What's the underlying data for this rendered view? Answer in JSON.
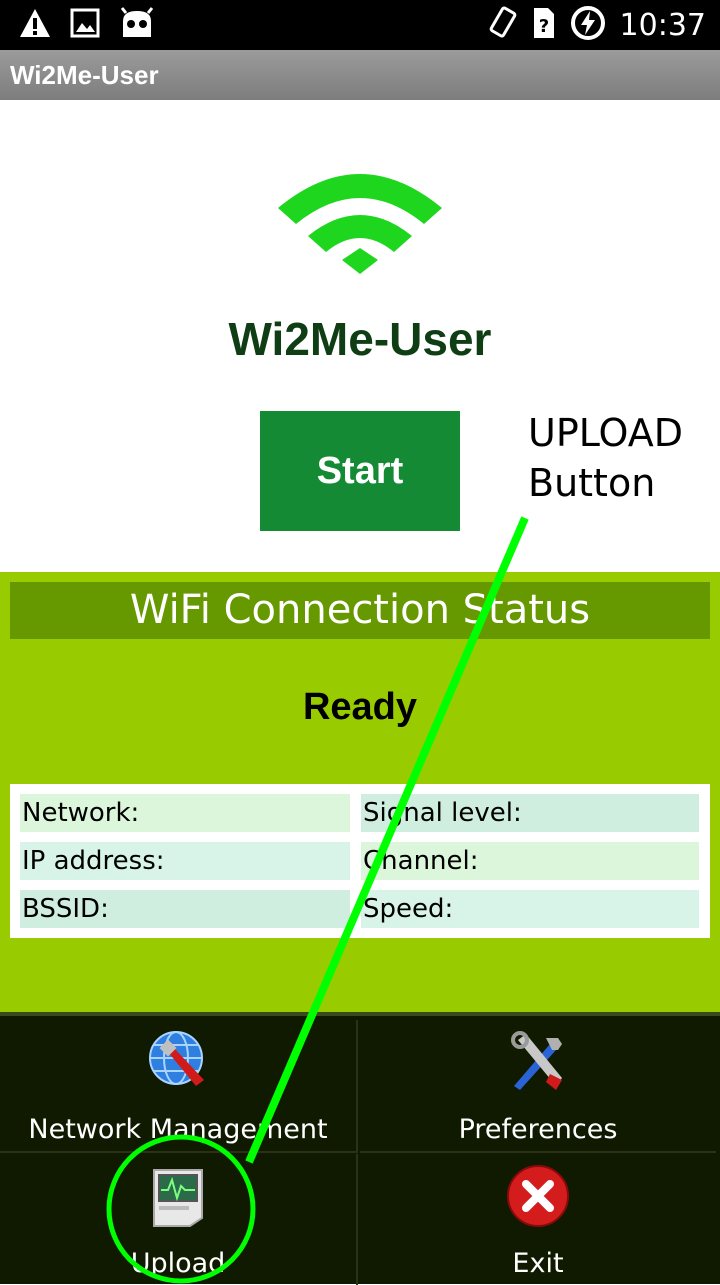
{
  "status_bar": {
    "time": "10:37",
    "icons": [
      "warning-icon",
      "image-icon",
      "android-icon",
      "rotate-icon",
      "sim-unknown-icon",
      "battery-charging-icon"
    ]
  },
  "app_bar": {
    "title": "Wi2Me-User"
  },
  "main": {
    "app_name": "Wi2Me-User",
    "start_label": "Start",
    "logo_icon": "wifi-icon"
  },
  "annotation": {
    "line1": "UPLOAD",
    "line2": "Button",
    "color": "#00ff00"
  },
  "status": {
    "header": "WiFi Connection Status",
    "value": "Ready",
    "fields": {
      "network": "Network:",
      "signal": "Signal level:",
      "ip": "IP address:",
      "channel": "Channel:",
      "bssid": "BSSID:",
      "speed": "Speed:"
    }
  },
  "menu": {
    "items": [
      {
        "label": "Network Management",
        "icon": "globe-wrench-icon"
      },
      {
        "label": "Preferences",
        "icon": "tools-icon"
      },
      {
        "label": "Upload",
        "icon": "upload-monitor-icon"
      },
      {
        "label": "Exit",
        "icon": "close-icon"
      }
    ]
  },
  "colors": {
    "accent_green": "#138a33",
    "panel_green": "#99cc00",
    "header_green": "#669900",
    "title_text": "#0f3d14"
  }
}
